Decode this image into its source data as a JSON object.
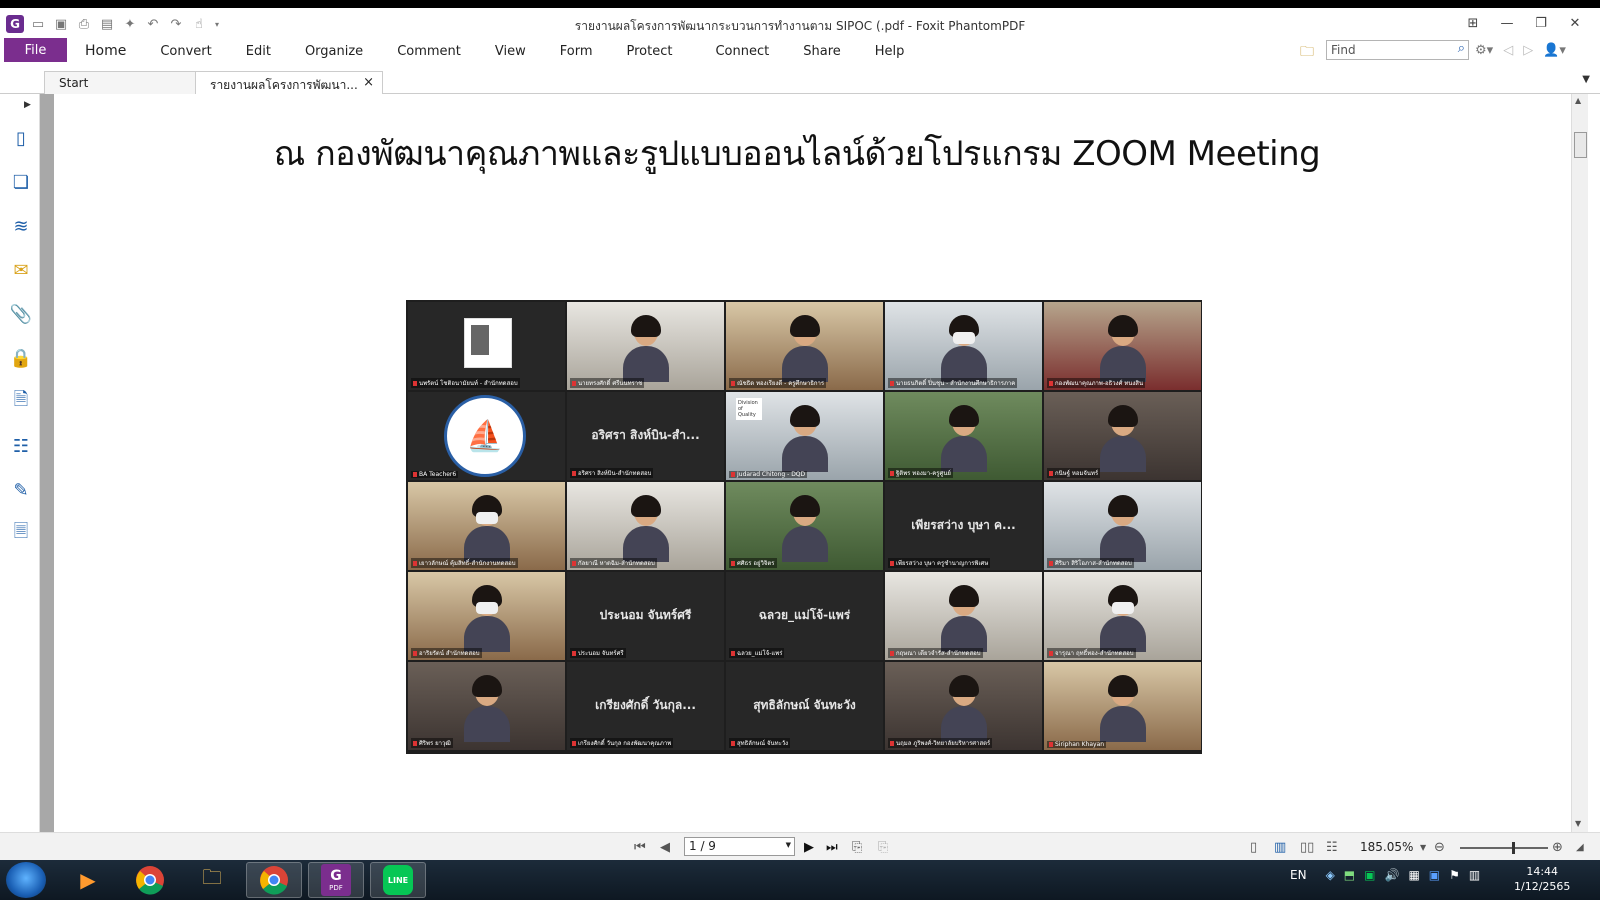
{
  "window": {
    "title": "รายงานผลโครงการพัฒนากระบวนการทำงานตาม SIPOC (.pdf - Foxit PhantomPDF",
    "app_logo": "G"
  },
  "ribbon": {
    "file_label": "File",
    "tabs": [
      "Home",
      "Convert",
      "Edit",
      "Organize",
      "Comment",
      "View",
      "Form",
      "Protect",
      "Connect",
      "Share",
      "Help"
    ],
    "find_placeholder": "Find"
  },
  "doc_tabs": {
    "start_label": "Start",
    "doc_label": "รายงานผลโครงการพัฒนา...",
    "close_glyph": "×"
  },
  "page": {
    "heading": "ณ กองพัฒนาคุณภาพและรูปแบบออนไลน์ด้วยโปรแกรม ZOOM Meeting"
  },
  "zoom": {
    "tiles": [
      {
        "type": "card",
        "style": "dark",
        "caption": "นพรัตน์ โชติอนามัยนท์ - สำนักทดสอบ"
      },
      {
        "type": "video",
        "style": "office",
        "caption": "นายทรงศักดิ์ ศรีนนทราช"
      },
      {
        "type": "video",
        "style": "warm",
        "caption": "ณัชธิด ทองเรียงดี - ครูศึกษาธิการ"
      },
      {
        "type": "video",
        "style": "cool",
        "mask": true,
        "caption": "นายธนกิตติ์ ปิ่นชุน - สำนักงานศึกษาธิการภาค"
      },
      {
        "type": "video",
        "style": "red",
        "caption": "กองพัฒนาคุณภาพ-อธิวงศ์ ทนงสิน"
      },
      {
        "type": "logo",
        "caption": "BA Teacher6"
      },
      {
        "type": "name",
        "name": "อริศรา สิงห์บิน-สำ...",
        "caption": "อริศรา สิงห์บิน-สำนักทดสอบ"
      },
      {
        "type": "video",
        "style": "cool",
        "badge": "Division of Quality",
        "caption": "Judarad Chitong - DQD"
      },
      {
        "type": "video",
        "style": "green",
        "caption": "ฐิติพร ทองมา-ครูศูนย์"
      },
      {
        "type": "video",
        "style": "dark",
        "caption": "กนิษฐ์ หอมจันทร์"
      },
      {
        "type": "video",
        "style": "warm",
        "mask": true,
        "caption": "เยาวลักษณ์ คุ้มสิทธิ์-สำนักงานทดสอบ"
      },
      {
        "type": "video",
        "style": "office",
        "caption": "กัลยาณี หาดฉิม-สำนักทดสอบ"
      },
      {
        "type": "video",
        "style": "green",
        "caption": "ศศิธร อยู่วิจิตร"
      },
      {
        "type": "name",
        "name": "เพียรสว่าง บุษา ค...",
        "caption": "เพียรสว่าง บุษา ครูชำนาญการพิเศษ"
      },
      {
        "type": "video",
        "style": "cool",
        "caption": "ศิริมา สิริโอภาส-สำนักทดสอบ"
      },
      {
        "type": "video",
        "style": "warm",
        "mask": true,
        "caption": "อาริยรัตน์ สำนักทดสอบ"
      },
      {
        "type": "name",
        "name": "ประนอม จันทร์ศรี",
        "caption": "ประนอม จันทร์ศรี"
      },
      {
        "type": "name",
        "name": "ฉลวย_แม่โจ้-แพร่",
        "caption": "ฉลวย_แม่โจ้-แพร่"
      },
      {
        "type": "video",
        "style": "office",
        "caption": "กฤษณา เดียวจำรัส-สำนักทดสอบ"
      },
      {
        "type": "video",
        "style": "office",
        "mask": true,
        "caption": "จารุณา ฤทธิ์ทอง-สำนักทดสอบ"
      },
      {
        "type": "video",
        "style": "dark",
        "caption": "ศิริพร ยาวุฒิ"
      },
      {
        "type": "name",
        "name": "เกรียงศักดิ์ วันกุล...",
        "caption": "เกรียงศักดิ์ วันกุล กองพัฒนาคุณภาพ"
      },
      {
        "type": "name",
        "name": "สุทธิลักษณ์ จันทะวัง",
        "caption": "สุทธิลักษณ์ จันทะวัง"
      },
      {
        "type": "video",
        "style": "dark",
        "caption": "นฤมล ภูริพงศ์-วิทยาลัยบริหารศาสตร์"
      },
      {
        "type": "video",
        "style": "warm",
        "caption": "Siriphan Khayan"
      }
    ]
  },
  "status": {
    "page_value": "1 / 9",
    "zoom_value": "185.05%"
  },
  "taskbar": {
    "lang": "EN",
    "time": "14:44",
    "date": "1/12/2565",
    "pdf_label": "PDF",
    "line_label": "LINE"
  },
  "colors": {
    "file_tab": "#7b2e8e",
    "accent": "#1f5fa8",
    "tile_bg": "#272727"
  }
}
